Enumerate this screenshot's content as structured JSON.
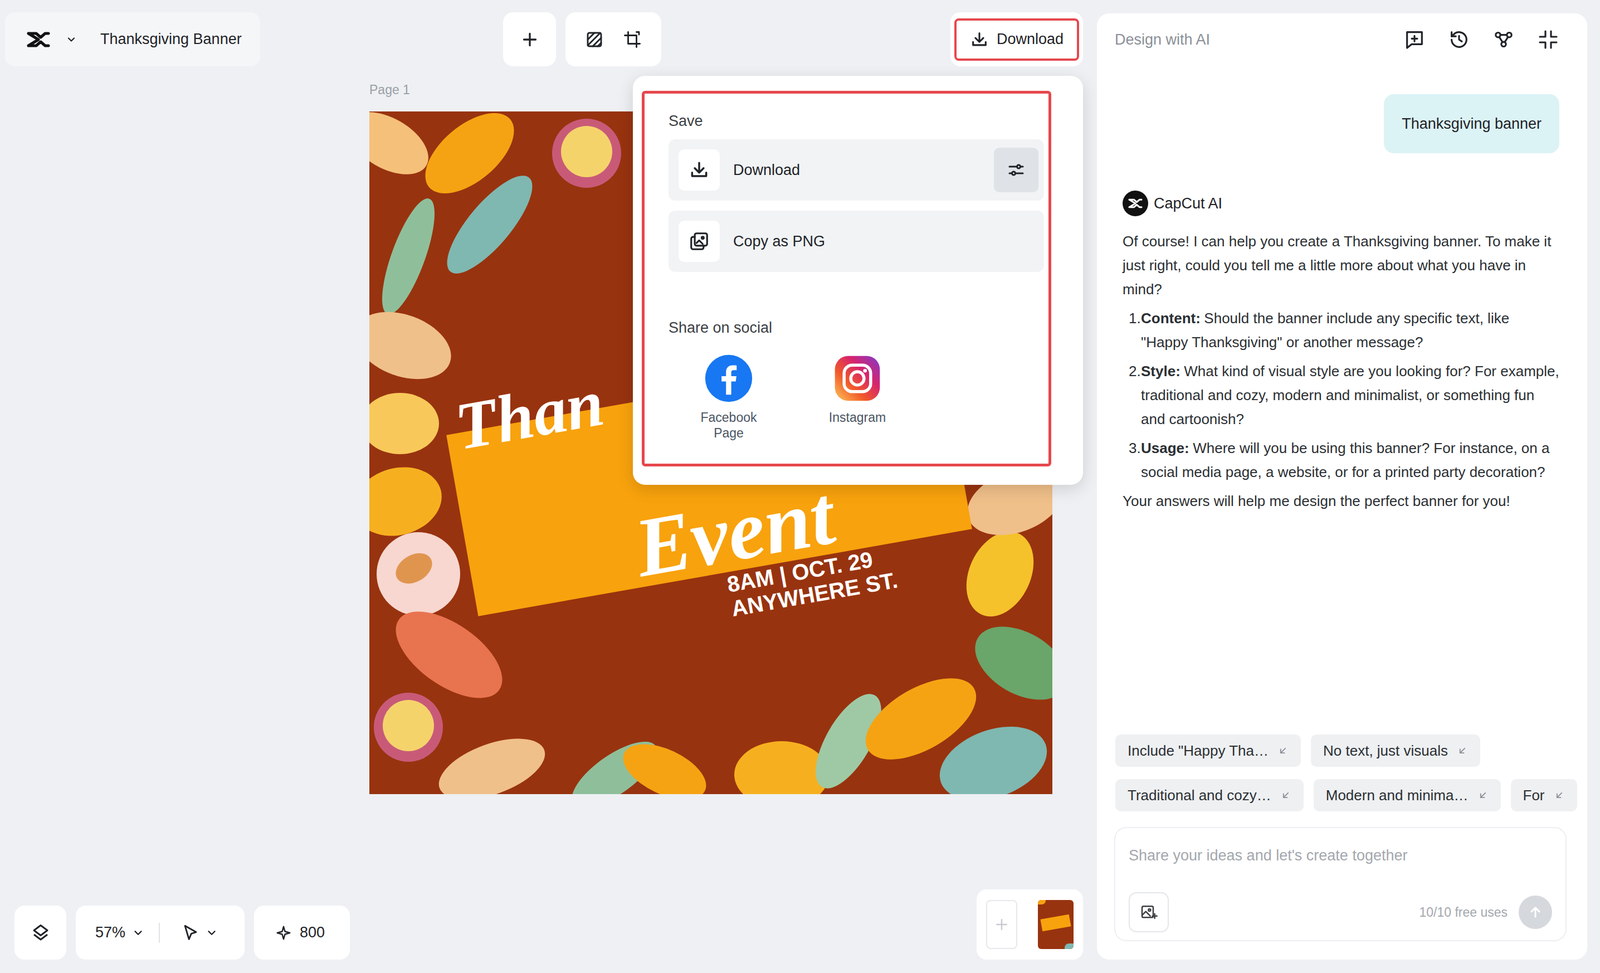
{
  "header": {
    "document_title": "Thanksgiving Banner",
    "download_button": {
      "label": "Download",
      "highlighted": true
    }
  },
  "export_menu": {
    "open": true,
    "highlighted": true,
    "save_heading": "Save",
    "actions": [
      {
        "label": "Download",
        "has_settings": true
      },
      {
        "label": "Copy as PNG",
        "has_settings": false
      }
    ],
    "share_heading": "Share on social",
    "social": [
      {
        "label": "Facebook Page",
        "kind": "facebook"
      },
      {
        "label": "Instagram",
        "kind": "instagram"
      }
    ]
  },
  "canvas": {
    "page_label": "Page 1",
    "design": {
      "title_line1": "Than",
      "title_line2": "Event",
      "details_line1": "8AM | OCT. 29",
      "details_line2": "ANYWHERE ST."
    }
  },
  "bottom_bar": {
    "zoom": "57%",
    "credits": "800"
  },
  "ai_panel": {
    "title": "Design with AI",
    "user_message": "Thanksgiving banner",
    "assistant": {
      "name": "CapCut AI",
      "intro": "Of course! I can help you create a Thanksgiving banner. To make it just right, could you tell me a little more about what you have in mind?",
      "questions": [
        {
          "number": "1.",
          "label": "Content:",
          "text": "Should the banner include any specific text, like \"Happy Thanksgiving\" or another message?"
        },
        {
          "number": "2.",
          "label": "Style:",
          "text": "What kind of visual style are you looking for? For example, traditional and cozy, modern and minimalist, or something fun and cartoonish?"
        },
        {
          "number": "3.",
          "label": "Usage:",
          "text": "Where will you be using this banner? For instance, on a social media page, a website, or for a printed party decoration?"
        }
      ],
      "outro": "Your answers will help me design the perfect banner for you!"
    },
    "suggestion_rows": [
      [
        "Include \"Happy Tha…",
        "No text, just visuals"
      ],
      [
        "Traditional and cozy…",
        "Modern and minima…",
        "For"
      ]
    ],
    "input": {
      "placeholder": "Share your ideas and let's create together",
      "usage": "10/10 free uses"
    }
  }
}
